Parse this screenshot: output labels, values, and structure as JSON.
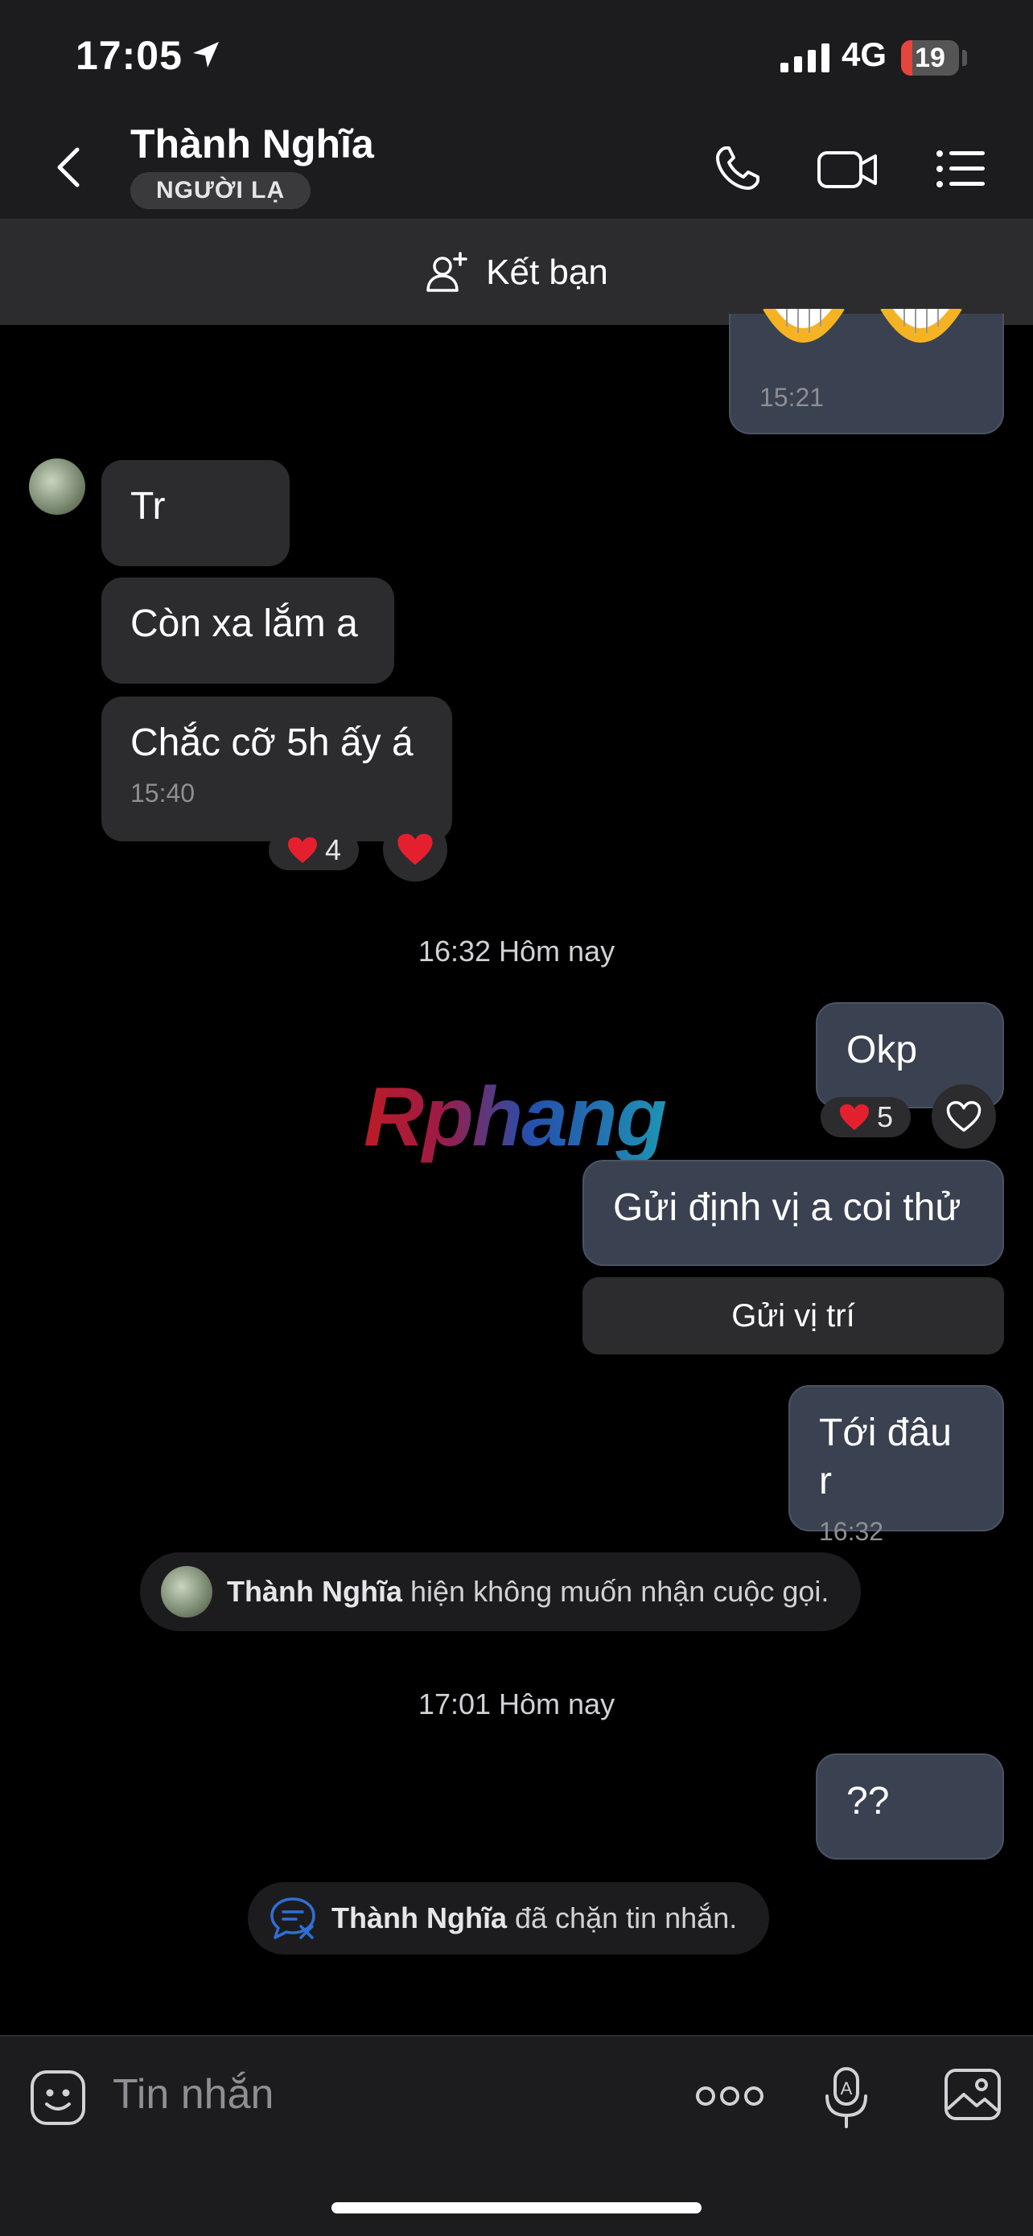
{
  "status_bar": {
    "time": "17:05",
    "network": "4G",
    "battery": "19",
    "battery_level_pct": 19
  },
  "header": {
    "contact_name": "Thành Nghĩa",
    "badge": "NGƯỜI LẠ",
    "icons": [
      "back-chevron-icon",
      "phone-icon",
      "video-camera-icon",
      "list-menu-icon"
    ]
  },
  "friend_bar": {
    "label": "Kết bạn",
    "icon": "add-friend-icon"
  },
  "messages": {
    "top_sticker_time": "15:21",
    "in_1": "Tr",
    "in_2": "Còn xa lắm a",
    "in_3": "Chắc cỡ 5h ấy á",
    "in_3_time": "15:40",
    "in_3_reaction_count": "4",
    "date_sep_1": "16:32 Hôm nay",
    "out_1": "Okp",
    "out_1_reaction_count": "5",
    "out_2": "Gửi định vị a coi thử",
    "out_2_action": "Gửi vị trí",
    "out_3": "Tới đâu r",
    "out_3_time": "16:32",
    "sys_1_name": "Thành Nghĩa",
    "sys_1_text": " hiện không muốn nhận cuộc gọi.",
    "date_sep_2": "17:01 Hôm nay",
    "out_4": "??",
    "sys_2_name": "Thành Nghĩa",
    "sys_2_text": " đã chặn tin nhắn."
  },
  "watermark": "Rphang",
  "composer": {
    "placeholder": "Tin nhắn",
    "icons": [
      "emoji-sticker-icon",
      "more-dots-icon",
      "voice-to-text-mic-icon",
      "photo-gallery-icon"
    ]
  },
  "colors": {
    "accent_heart": "#e5202e",
    "outgoing_bubble": "#3a4150",
    "incoming_bubble": "#2c2c2e",
    "block_icon": "#2f6fd6"
  }
}
